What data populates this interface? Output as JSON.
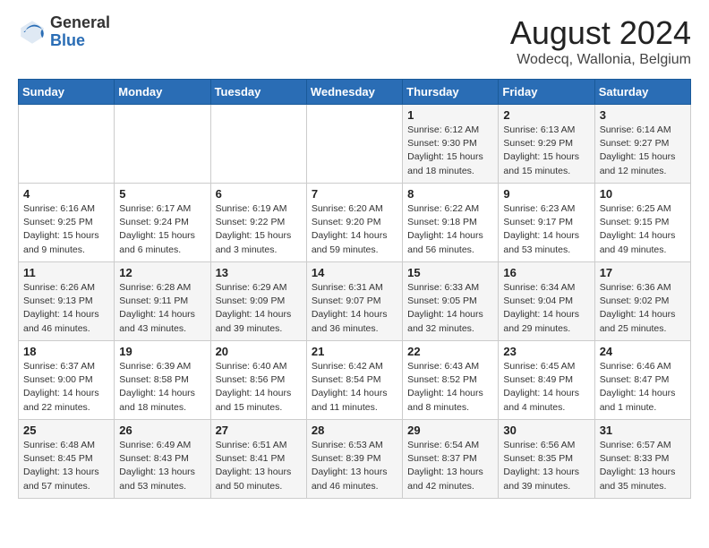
{
  "header": {
    "logo_general": "General",
    "logo_blue": "Blue",
    "title": "August 2024",
    "subtitle": "Wodecq, Wallonia, Belgium"
  },
  "days_of_week": [
    "Sunday",
    "Monday",
    "Tuesday",
    "Wednesday",
    "Thursday",
    "Friday",
    "Saturday"
  ],
  "weeks": [
    [
      {
        "day": "",
        "info": ""
      },
      {
        "day": "",
        "info": ""
      },
      {
        "day": "",
        "info": ""
      },
      {
        "day": "",
        "info": ""
      },
      {
        "day": "1",
        "info": "Sunrise: 6:12 AM\nSunset: 9:30 PM\nDaylight: 15 hours\nand 18 minutes."
      },
      {
        "day": "2",
        "info": "Sunrise: 6:13 AM\nSunset: 9:29 PM\nDaylight: 15 hours\nand 15 minutes."
      },
      {
        "day": "3",
        "info": "Sunrise: 6:14 AM\nSunset: 9:27 PM\nDaylight: 15 hours\nand 12 minutes."
      }
    ],
    [
      {
        "day": "4",
        "info": "Sunrise: 6:16 AM\nSunset: 9:25 PM\nDaylight: 15 hours\nand 9 minutes."
      },
      {
        "day": "5",
        "info": "Sunrise: 6:17 AM\nSunset: 9:24 PM\nDaylight: 15 hours\nand 6 minutes."
      },
      {
        "day": "6",
        "info": "Sunrise: 6:19 AM\nSunset: 9:22 PM\nDaylight: 15 hours\nand 3 minutes."
      },
      {
        "day": "7",
        "info": "Sunrise: 6:20 AM\nSunset: 9:20 PM\nDaylight: 14 hours\nand 59 minutes."
      },
      {
        "day": "8",
        "info": "Sunrise: 6:22 AM\nSunset: 9:18 PM\nDaylight: 14 hours\nand 56 minutes."
      },
      {
        "day": "9",
        "info": "Sunrise: 6:23 AM\nSunset: 9:17 PM\nDaylight: 14 hours\nand 53 minutes."
      },
      {
        "day": "10",
        "info": "Sunrise: 6:25 AM\nSunset: 9:15 PM\nDaylight: 14 hours\nand 49 minutes."
      }
    ],
    [
      {
        "day": "11",
        "info": "Sunrise: 6:26 AM\nSunset: 9:13 PM\nDaylight: 14 hours\nand 46 minutes."
      },
      {
        "day": "12",
        "info": "Sunrise: 6:28 AM\nSunset: 9:11 PM\nDaylight: 14 hours\nand 43 minutes."
      },
      {
        "day": "13",
        "info": "Sunrise: 6:29 AM\nSunset: 9:09 PM\nDaylight: 14 hours\nand 39 minutes."
      },
      {
        "day": "14",
        "info": "Sunrise: 6:31 AM\nSunset: 9:07 PM\nDaylight: 14 hours\nand 36 minutes."
      },
      {
        "day": "15",
        "info": "Sunrise: 6:33 AM\nSunset: 9:05 PM\nDaylight: 14 hours\nand 32 minutes."
      },
      {
        "day": "16",
        "info": "Sunrise: 6:34 AM\nSunset: 9:04 PM\nDaylight: 14 hours\nand 29 minutes."
      },
      {
        "day": "17",
        "info": "Sunrise: 6:36 AM\nSunset: 9:02 PM\nDaylight: 14 hours\nand 25 minutes."
      }
    ],
    [
      {
        "day": "18",
        "info": "Sunrise: 6:37 AM\nSunset: 9:00 PM\nDaylight: 14 hours\nand 22 minutes."
      },
      {
        "day": "19",
        "info": "Sunrise: 6:39 AM\nSunset: 8:58 PM\nDaylight: 14 hours\nand 18 minutes."
      },
      {
        "day": "20",
        "info": "Sunrise: 6:40 AM\nSunset: 8:56 PM\nDaylight: 14 hours\nand 15 minutes."
      },
      {
        "day": "21",
        "info": "Sunrise: 6:42 AM\nSunset: 8:54 PM\nDaylight: 14 hours\nand 11 minutes."
      },
      {
        "day": "22",
        "info": "Sunrise: 6:43 AM\nSunset: 8:52 PM\nDaylight: 14 hours\nand 8 minutes."
      },
      {
        "day": "23",
        "info": "Sunrise: 6:45 AM\nSunset: 8:49 PM\nDaylight: 14 hours\nand 4 minutes."
      },
      {
        "day": "24",
        "info": "Sunrise: 6:46 AM\nSunset: 8:47 PM\nDaylight: 14 hours\nand 1 minute."
      }
    ],
    [
      {
        "day": "25",
        "info": "Sunrise: 6:48 AM\nSunset: 8:45 PM\nDaylight: 13 hours\nand 57 minutes."
      },
      {
        "day": "26",
        "info": "Sunrise: 6:49 AM\nSunset: 8:43 PM\nDaylight: 13 hours\nand 53 minutes."
      },
      {
        "day": "27",
        "info": "Sunrise: 6:51 AM\nSunset: 8:41 PM\nDaylight: 13 hours\nand 50 minutes."
      },
      {
        "day": "28",
        "info": "Sunrise: 6:53 AM\nSunset: 8:39 PM\nDaylight: 13 hours\nand 46 minutes."
      },
      {
        "day": "29",
        "info": "Sunrise: 6:54 AM\nSunset: 8:37 PM\nDaylight: 13 hours\nand 42 minutes."
      },
      {
        "day": "30",
        "info": "Sunrise: 6:56 AM\nSunset: 8:35 PM\nDaylight: 13 hours\nand 39 minutes."
      },
      {
        "day": "31",
        "info": "Sunrise: 6:57 AM\nSunset: 8:33 PM\nDaylight: 13 hours\nand 35 minutes."
      }
    ]
  ]
}
